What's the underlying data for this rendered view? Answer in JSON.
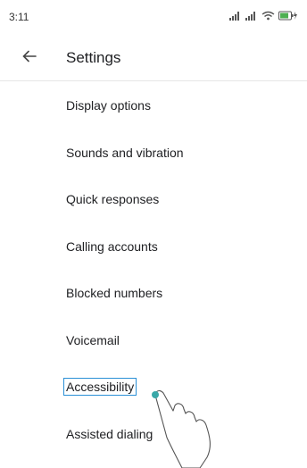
{
  "status_bar": {
    "time": "3:11",
    "icons": [
      "signal-icon",
      "signal-icon",
      "wifi-icon",
      "battery-charging-icon"
    ],
    "battery_color": "#4caf50"
  },
  "header": {
    "back_icon": "arrow-left-icon",
    "title": "Settings"
  },
  "settings_items": [
    {
      "label": "Display options"
    },
    {
      "label": "Sounds and vibration"
    },
    {
      "label": "Quick responses"
    },
    {
      "label": "Calling accounts"
    },
    {
      "label": "Blocked numbers"
    },
    {
      "label": "Voicemail"
    },
    {
      "label": "Accessibility",
      "focused": true
    },
    {
      "label": "Assisted dialing"
    }
  ],
  "overlay": {
    "touch_indicator_icon": "hand-pointer-icon",
    "touch_dot_color": "#3aa8a8",
    "focus_color": "#2a8fd6"
  }
}
